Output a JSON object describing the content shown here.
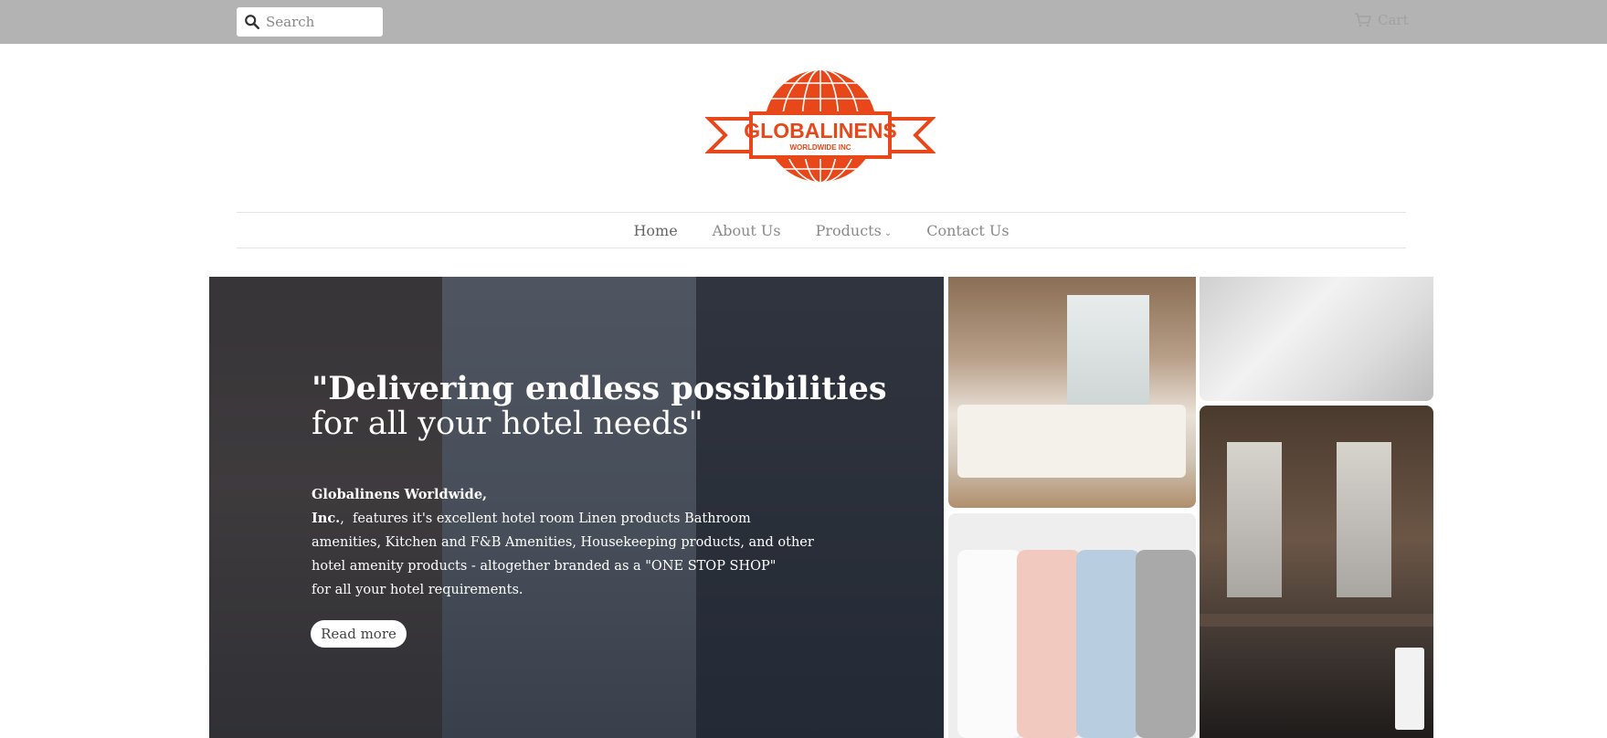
{
  "topbar": {
    "search_placeholder": "Search",
    "search_icon": "search-icon",
    "cart_label": "Cart",
    "cart_icon": "cart-icon"
  },
  "logo": {
    "brand": "GLOBALINENS",
    "tagline": "WORLDWIDE INC",
    "color": "#e8471a"
  },
  "nav": {
    "items": [
      {
        "label": "Home"
      },
      {
        "label": "About Us"
      },
      {
        "label": "Products"
      },
      {
        "label": "Contact Us"
      }
    ]
  },
  "hero": {
    "headline_bold": "\"Delivering endless possibilities",
    "headline_regular": "for all your hotel needs\"",
    "company": "Globalinens Worldwide, Inc.",
    "line1": ",  features it's excellent hotel room Linen products Bathroom",
    "line2": "amenities, Kitchen and F&B Amenities, Housekeeping products, and other",
    "line3": "hotel amenity products - altogether branded as a \"ONE STOP SHOP\"",
    "line4": "for all your hotel requirements.",
    "button": "Read more"
  },
  "colors": {
    "topbar": "#b3b3b3",
    "accent": "#e8471a",
    "nav_text": "#8a8a8a"
  }
}
